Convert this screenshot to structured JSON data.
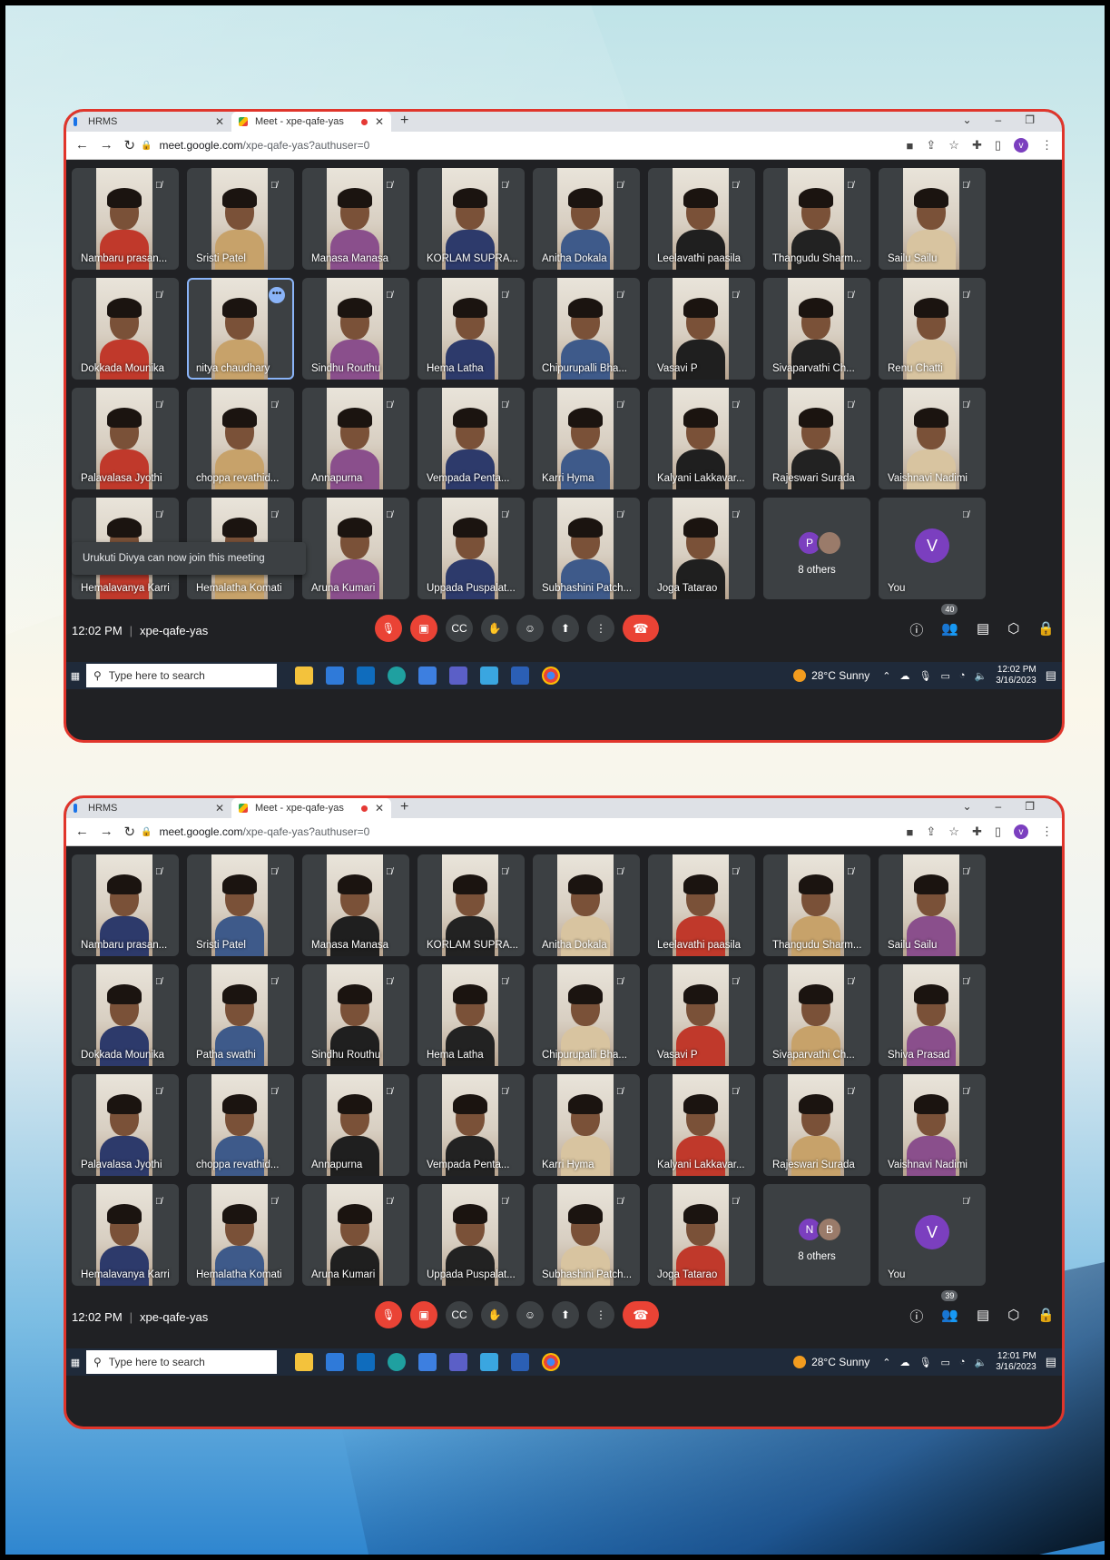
{
  "browser": {
    "tab1": "HRMS",
    "tab2": "Meet - xpe-qafe-yas",
    "url_host": "meet.google.com",
    "url_path": "/xpe-qafe-yas?authuser=0",
    "avatar_letter": "v"
  },
  "screens": [
    {
      "participants": [
        "Nambaru prasan...",
        "Sristi Patel",
        "Manasa Manasa",
        "KORLAM SUPRA...",
        "Anitha Dokala",
        "Leelavathi paasila",
        "Thangudu Sharm...",
        "Sailu Sailu",
        "Dokkada Mounika",
        "nitya chaudhary",
        "Sindhu Routhu",
        "Hema Latha",
        "Chipurupalli Bha...",
        "Vasavi P",
        "Sivaparvathi Ch...",
        "Renu Chatti",
        "Palavalasa Jyothi",
        "choppa revathid...",
        "Annapurna",
        "Vempada Penta...",
        "Karri Hyma",
        "Kalyani Lakkavar...",
        "Rajeswari Surada",
        "Vaishnavi Nadimi",
        "Hemalavanya Karri",
        "Hemalatha Komati",
        "Aruna Kumari",
        "Uppada Puspalat...",
        "Subhashini Patch...",
        "Joga Tatarao"
      ],
      "others_label": "8 others",
      "others_avatars": [
        "P",
        ""
      ],
      "you_label": "You",
      "you_letter": "V",
      "toast": "Urukuti Divya can now join this meeting",
      "time": "12:02 PM",
      "meeting_code": "xpe-qafe-yas",
      "people_count": "40",
      "taskbar_search": "Type here to search",
      "weather": "28°C  Sunny",
      "tray_time": "12:02 PM",
      "tray_date": "3/16/2023"
    },
    {
      "participants": [
        "Nambaru prasan...",
        "Sristi Patel",
        "Manasa Manasa",
        "KORLAM SUPRA...",
        "Anitha Dokala",
        "Leelavathi paasila",
        "Thangudu Sharm...",
        "Sailu Sailu",
        "Dokkada Mounika",
        "Patha swathi",
        "Sindhu Routhu",
        "Hema Latha",
        "Chipurupalli Bha...",
        "Vasavi P",
        "Sivaparvathi Ch...",
        "Shiva Prasad",
        "Palavalasa Jyothi",
        "choppa revathid...",
        "Annapurna",
        "Vempada Penta...",
        "Karri Hyma",
        "Kalyani Lakkavar...",
        "Rajeswari Surada",
        "Vaishnavi Nadimi",
        "Hemalavanya Karri",
        "Hemalatha Komati",
        "Aruna Kumari",
        "Uppada Puspalat...",
        "Subhashini Patch...",
        "Joga Tatarao"
      ],
      "others_label": "8 others",
      "others_avatars": [
        "N",
        "B"
      ],
      "you_label": "You",
      "you_letter": "V",
      "toast": "",
      "time": "12:02 PM",
      "meeting_code": "xpe-qafe-yas",
      "people_count": "39",
      "taskbar_search": "Type here to search",
      "weather": "28°C  Sunny",
      "tray_time": "12:01 PM",
      "tray_date": "3/16/2023"
    }
  ]
}
